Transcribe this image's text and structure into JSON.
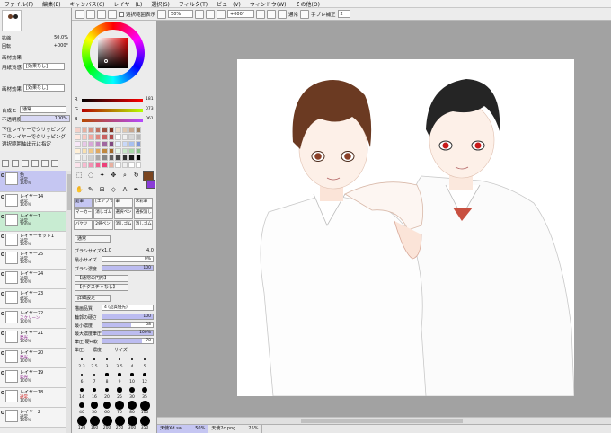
{
  "menu": [
    "ファイル(F)",
    "編集(E)",
    "キャンバス(C)",
    "レイヤー(L)",
    "選択(S)",
    "フィルタ(T)",
    "ビュー(V)",
    "ウィンドウ(W)",
    "その他(O)"
  ],
  "toolbar": {
    "selection_check_label": "選択範囲表示",
    "zoom": "50%",
    "angle": "+000°",
    "blend_mode": "通常",
    "stabilizer_label": "手ブレ補正",
    "stabilizer_value": "2"
  },
  "navigator": {
    "zoom_label": "拡縮",
    "zoom_value": "50.0%",
    "angle_label": "回転",
    "angle_value": "+000°"
  },
  "layer_panel": {
    "effect_header": "画材効果",
    "texture_label": "用紙質感",
    "texture_value": "[効果なし]",
    "paint_effect_label": "画材効果",
    "paint_effect_value": "[効果なし]",
    "mode_label": "合成モード",
    "mode_value": "通常",
    "opacity_label": "不透明度",
    "opacity_value": "100%",
    "check1": "下位レイヤーでクリッピング",
    "check2": "下のレイヤーでクリッピング",
    "check3": "選択範囲抽出元に指定"
  },
  "layers": [
    {
      "name": "色",
      "mode": "通常",
      "opacity": "100%",
      "variant": "sel"
    },
    {
      "name": "レイヤー14",
      "mode": "通常",
      "opacity": "100%",
      "variant": ""
    },
    {
      "name": "レイヤー1",
      "mode": "通常",
      "opacity": "100%",
      "variant": "grn"
    },
    {
      "name": "レイヤーセット1",
      "mode": "通常",
      "opacity": "100%",
      "variant": ""
    },
    {
      "name": "レイヤー25",
      "mode": "通常",
      "opacity": "100%",
      "variant": ""
    },
    {
      "name": "レイヤー24",
      "mode": "通常",
      "opacity": "100%",
      "variant": ""
    },
    {
      "name": "レイヤー23",
      "mode": "通常",
      "opacity": "100%",
      "variant": ""
    },
    {
      "name": "レイヤー22",
      "mode": "スクリーン",
      "opacity": "100%",
      "variant": "pur"
    },
    {
      "name": "レイヤー21",
      "mode": "発光",
      "opacity": "100%",
      "variant": "pur"
    },
    {
      "name": "レイヤー20",
      "mode": "発光",
      "opacity": "100%",
      "variant": "pur"
    },
    {
      "name": "レイヤー19",
      "mode": "発光",
      "opacity": "100%",
      "variant": "pur"
    },
    {
      "name": "レイヤー18",
      "mode": "通常",
      "opacity": "100%",
      "variant": "red"
    },
    {
      "name": "レイヤー2",
      "mode": "通常",
      "opacity": "100%",
      "variant": ""
    }
  ],
  "color": {
    "r_label": "R",
    "r_value": "181",
    "g_label": "G",
    "g_value": "073",
    "b_label": "B",
    "b_value": "061",
    "fg": "#7a4520",
    "bg": "#8a3cd8"
  },
  "brush_tools": [
    "鉛筆",
    "[エアブラシ]",
    "筆",
    "水彩筆",
    "マーカー",
    "消しゴム",
    "選択ペン",
    "選択消し",
    "バケツ",
    "2値ペン",
    "消しゴム",
    "消しゴム"
  ],
  "brush_props": {
    "mode_value": "通常",
    "size_label": "ブラシサイズ",
    "size_mult": "x1.0",
    "size_value": "4.0",
    "min_size_label": "最小サイズ",
    "min_size_value": "0%",
    "density_label": "ブラシ濃度",
    "density_value": "100",
    "shape_value": "【通常の円形】",
    "texture_value": "【テクスチャなし】",
    "detail_header": "詳細設定",
    "quality_label": "描画品質",
    "quality_value": "4 (品質優先)",
    "edge_label": "輪郭の硬さ",
    "edge_value": "100",
    "min_density_label": "最小濃度",
    "min_density_value": "58",
    "max_pressure_label": "最大濃度筆圧",
    "max_pressure_value": "100%",
    "pressure_label": "筆圧 硬⇔軟",
    "pressure_value": "78",
    "pressure2_label": "筆圧:",
    "pressure2_a": "濃度",
    "pressure2_b": "サイズ"
  },
  "brush_sizes": [
    "2.3",
    "2.5",
    "3",
    "3.5",
    "4",
    "5",
    "6",
    "7",
    "8",
    "9",
    "10",
    "12",
    "14",
    "16",
    "20",
    "25",
    "30",
    "35",
    "40",
    "50",
    "60",
    "70",
    "80",
    "100",
    "120",
    "160",
    "200",
    "250",
    "300",
    "350"
  ],
  "tabs": [
    {
      "name": "天使Xd.sai",
      "zoom": "50%",
      "active": true
    },
    {
      "name": "天使2c.png",
      "zoom": "25%",
      "active": false
    }
  ]
}
